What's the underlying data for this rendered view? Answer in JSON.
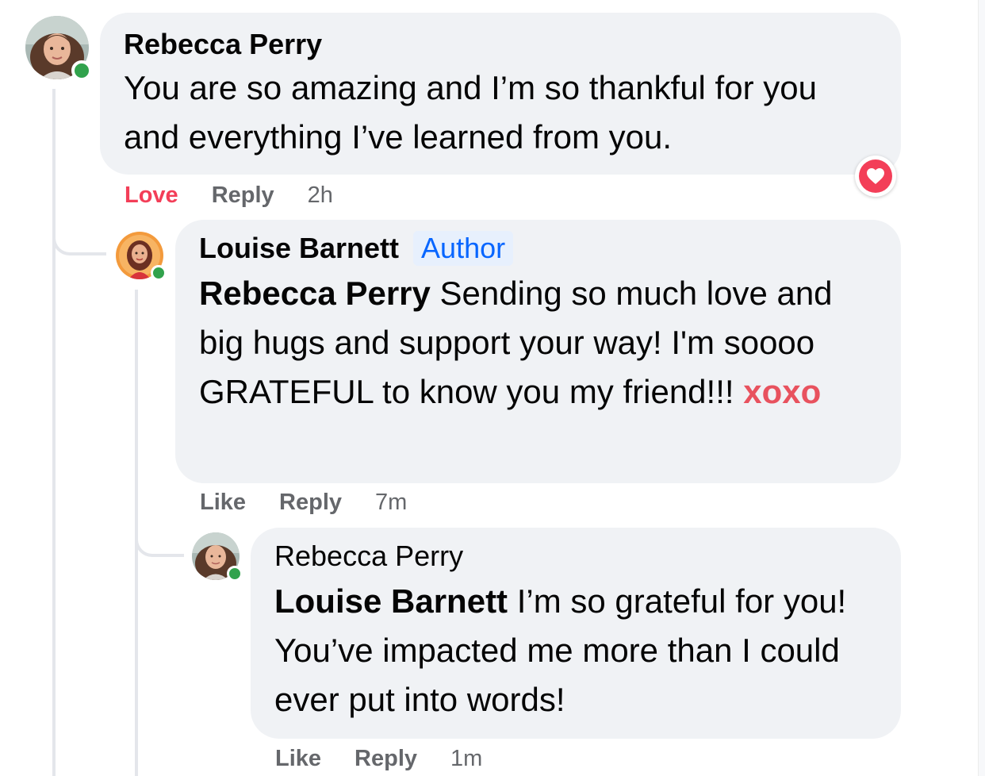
{
  "comments": [
    {
      "author": "Rebecca Perry",
      "body": "You are so amazing and I’m so thankful for you and everything I’ve learned from you.",
      "actions": {
        "react": "Love",
        "reply": "Reply",
        "time": "2h"
      },
      "reaction": "love-heart",
      "online": true
    },
    {
      "author": "Louise Barnett",
      "badge": "Author",
      "mention": "Rebecca Perry",
      "body": " Sending so much love and big hugs and support your way! I'm soooo GRATEFUL to know you my friend!!! ",
      "highlight": "xoxo",
      "actions": {
        "react": "Like",
        "reply": "Reply",
        "time": "7m"
      },
      "online": true
    },
    {
      "author": "Rebecca Perry",
      "mention": "Louise Barnett",
      "body": " I’m so grateful for you! You’ve impacted me more than I could ever put into words!",
      "actions": {
        "react": "Like",
        "reply": "Reply",
        "time": "1m"
      },
      "online": true
    }
  ],
  "colors": {
    "bubble": "#f0f2f5",
    "love": "#f33e58",
    "author_badge_bg": "#e7f0fd",
    "author_badge_text": "#0866ff",
    "online": "#31a24c",
    "meta": "#65676b"
  }
}
